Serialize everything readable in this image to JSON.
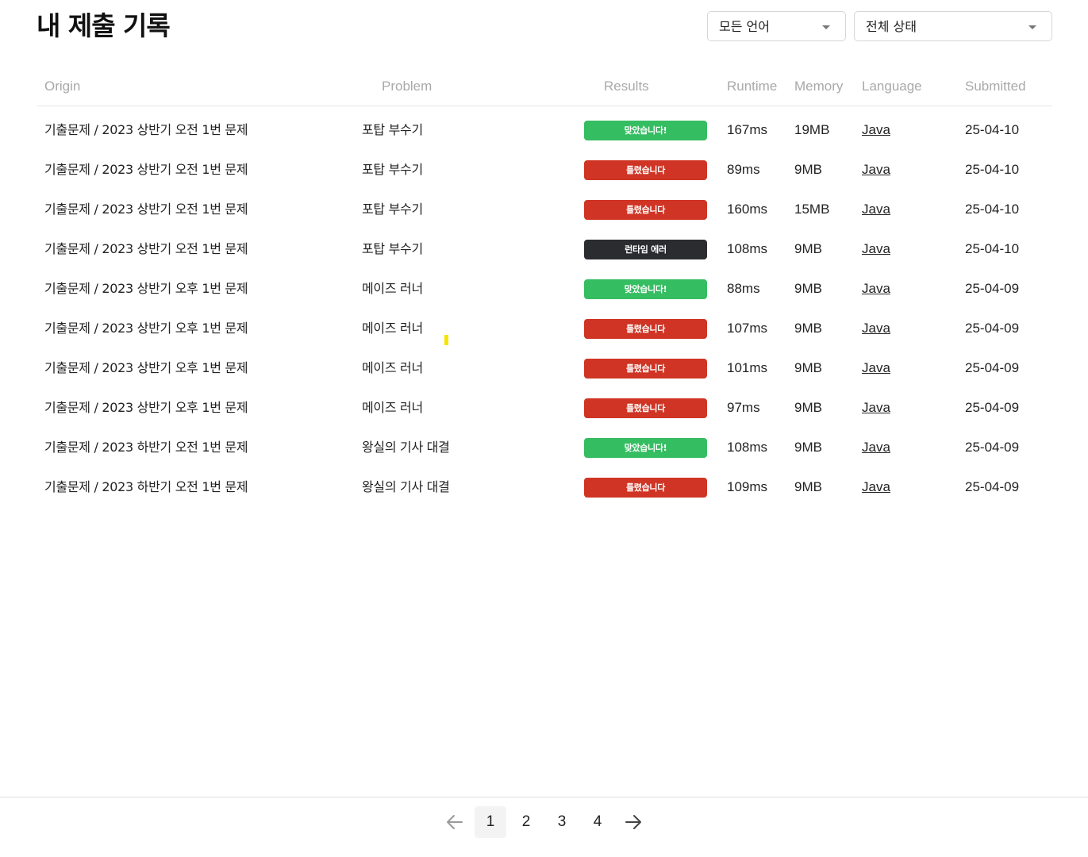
{
  "page": {
    "title": "내 제출 기록"
  },
  "filters": {
    "language": {
      "selected": "모든 언어"
    },
    "status": {
      "selected": "전체 상태"
    }
  },
  "table": {
    "headers": {
      "origin": "Origin",
      "problem": "Problem",
      "results": "Results",
      "runtime": "Runtime",
      "memory": "Memory",
      "language": "Language",
      "submitted": "Submitted"
    },
    "rows": [
      {
        "origin": "기출문제 / 2023 상반기 오전 1번 문제",
        "problem": "포탑 부수기",
        "result": "맞았습니다!",
        "status": "ok",
        "runtime": "167ms",
        "memory": "19MB",
        "language": "Java",
        "submitted": "25-04-10"
      },
      {
        "origin": "기출문제 / 2023 상반기 오전 1번 문제",
        "problem": "포탑 부수기",
        "result": "틀렸습니다",
        "status": "wrong",
        "runtime": "89ms",
        "memory": "9MB",
        "language": "Java",
        "submitted": "25-04-10"
      },
      {
        "origin": "기출문제 / 2023 상반기 오전 1번 문제",
        "problem": "포탑 부수기",
        "result": "틀렸습니다",
        "status": "wrong",
        "runtime": "160ms",
        "memory": "15MB",
        "language": "Java",
        "submitted": "25-04-10"
      },
      {
        "origin": "기출문제 / 2023 상반기 오전 1번 문제",
        "problem": "포탑 부수기",
        "result": "런타임 에러",
        "status": "error",
        "runtime": "108ms",
        "memory": "9MB",
        "language": "Java",
        "submitted": "25-04-10"
      },
      {
        "origin": "기출문제 / 2023 상반기 오후 1번 문제",
        "problem": "메이즈 러너",
        "result": "맞았습니다!",
        "status": "ok",
        "runtime": "88ms",
        "memory": "9MB",
        "language": "Java",
        "submitted": "25-04-09"
      },
      {
        "origin": "기출문제 / 2023 상반기 오후 1번 문제",
        "problem": "메이즈 러너",
        "result": "틀렸습니다",
        "status": "wrong",
        "runtime": "107ms",
        "memory": "9MB",
        "language": "Java",
        "submitted": "25-04-09"
      },
      {
        "origin": "기출문제 / 2023 상반기 오후 1번 문제",
        "problem": "메이즈 러너",
        "result": "틀렸습니다",
        "status": "wrong",
        "runtime": "101ms",
        "memory": "9MB",
        "language": "Java",
        "submitted": "25-04-09"
      },
      {
        "origin": "기출문제 / 2023 상반기 오후 1번 문제",
        "problem": "메이즈 러너",
        "result": "틀렸습니다",
        "status": "wrong",
        "runtime": "97ms",
        "memory": "9MB",
        "language": "Java",
        "submitted": "25-04-09"
      },
      {
        "origin": "기출문제 / 2023 하반기 오전 1번 문제",
        "problem": "왕실의 기사 대결",
        "result": "맞았습니다!",
        "status": "ok",
        "runtime": "108ms",
        "memory": "9MB",
        "language": "Java",
        "submitted": "25-04-09"
      },
      {
        "origin": "기출문제 / 2023 하반기 오전 1번 문제",
        "problem": "왕실의 기사 대결",
        "result": "틀렸습니다",
        "status": "wrong",
        "runtime": "109ms",
        "memory": "9MB",
        "language": "Java",
        "submitted": "25-04-09"
      }
    ]
  },
  "pagination": {
    "current": "1",
    "pages": [
      "1",
      "2",
      "3",
      "4"
    ],
    "prev_icon": "arrow-left-icon",
    "next_icon": "arrow-right-icon"
  },
  "colors": {
    "ok": "#35bd62",
    "wrong": "#cf3424",
    "error": "#2b2c30"
  }
}
